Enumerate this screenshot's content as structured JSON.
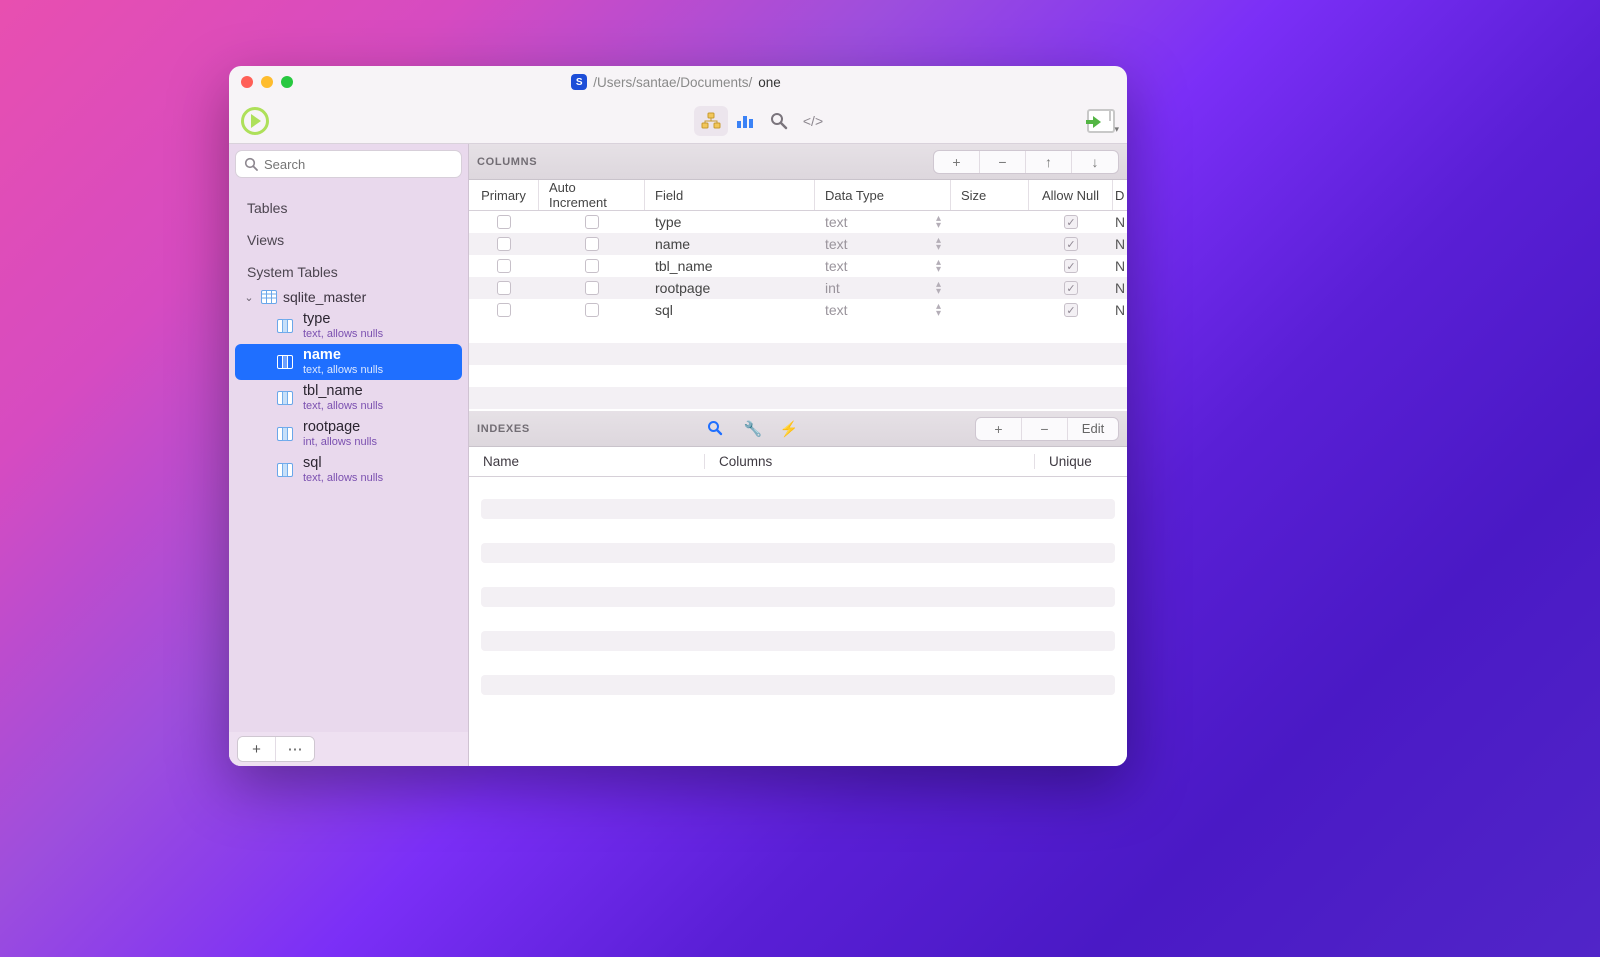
{
  "title": {
    "path_prefix": "/Users/santae/Documents/",
    "path_name": "one"
  },
  "search": {
    "placeholder": "Search"
  },
  "sidebar": {
    "sections": {
      "tables": "Tables",
      "views": "Views",
      "system": "System Tables"
    },
    "system_table": "sqlite_master",
    "columns": [
      {
        "name": "type",
        "sub": "text, allows nulls",
        "selected": false
      },
      {
        "name": "name",
        "sub": "text, allows nulls",
        "selected": true
      },
      {
        "name": "tbl_name",
        "sub": "text, allows nulls",
        "selected": false
      },
      {
        "name": "rootpage",
        "sub": "int, allows nulls",
        "selected": false
      },
      {
        "name": "sql",
        "sub": "text, allows nulls",
        "selected": false
      }
    ]
  },
  "columns_panel": {
    "title": "COLUMNS",
    "headers": {
      "primary": "Primary",
      "ai": "Auto Increment",
      "field": "Field",
      "dtype": "Data Type",
      "size": "Size",
      "null": "Allow Null",
      "def": "D"
    },
    "rows": [
      {
        "field": "type",
        "dtype": "text",
        "allow_null": true,
        "def": "N"
      },
      {
        "field": "name",
        "dtype": "text",
        "allow_null": true,
        "def": "N"
      },
      {
        "field": "tbl_name",
        "dtype": "text",
        "allow_null": true,
        "def": "N"
      },
      {
        "field": "rootpage",
        "dtype": "int",
        "allow_null": true,
        "def": "N"
      },
      {
        "field": "sql",
        "dtype": "text",
        "allow_null": true,
        "def": "N"
      }
    ]
  },
  "indexes_panel": {
    "title": "INDEXES",
    "edit_label": "Edit",
    "headers": {
      "name": "Name",
      "columns": "Columns",
      "unique": "Unique"
    }
  }
}
